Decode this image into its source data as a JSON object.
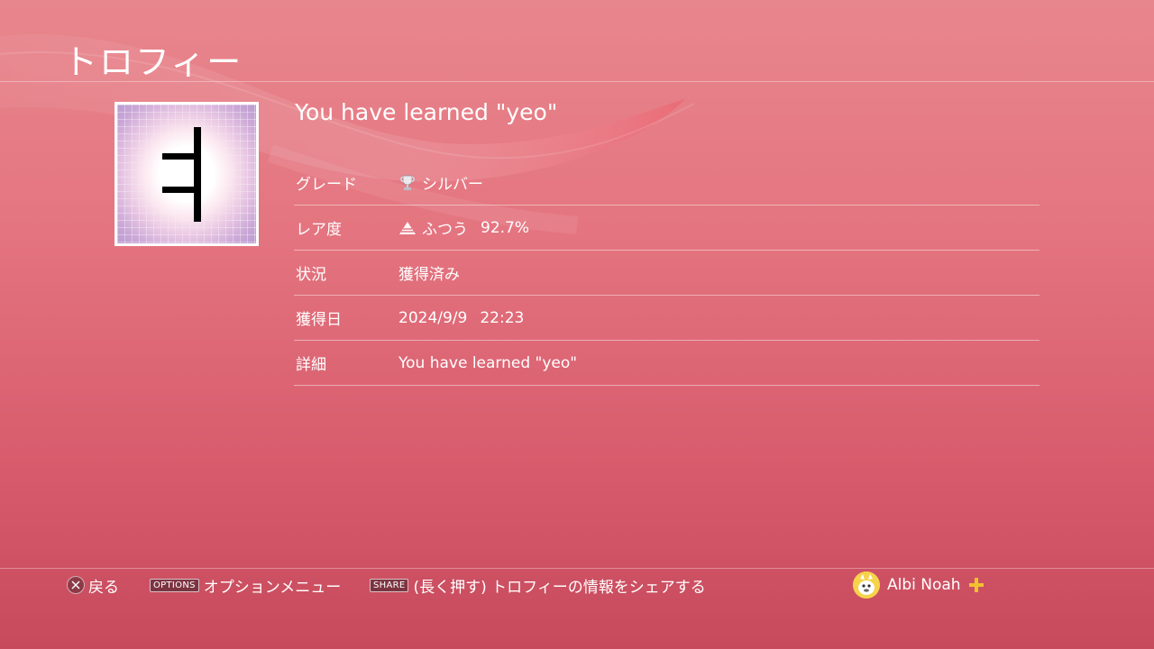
{
  "header": {
    "title": "トロフィー"
  },
  "trophy": {
    "name": "You have learned \"yeo\"",
    "icon": "hangul-yeo-glyph-icon"
  },
  "details": [
    {
      "label": "グレード",
      "value": "シルバー",
      "icon": "silver-trophy-icon"
    },
    {
      "label": "レア度",
      "value": "ふつう",
      "extra": "92.7%",
      "icon": "rarity-pyramid-icon"
    },
    {
      "label": "状況",
      "value": "獲得済み"
    },
    {
      "label": "獲得日",
      "value": "2024/9/9",
      "extra": "22:23"
    },
    {
      "label": "詳細",
      "value": "You have learned \"yeo\""
    }
  ],
  "footer": {
    "back_label": "戻る",
    "options_key": "OPTIONS",
    "options_label": "オプションメニュー",
    "share_key": "SHARE",
    "share_label": "(長く押す) トロフィーの情報をシェアする",
    "user_name": "Albi Noah"
  },
  "colors": {
    "background_top": "#e8868d",
    "background_bottom": "#c64a5c",
    "plus_gold": "#f2c12e"
  }
}
